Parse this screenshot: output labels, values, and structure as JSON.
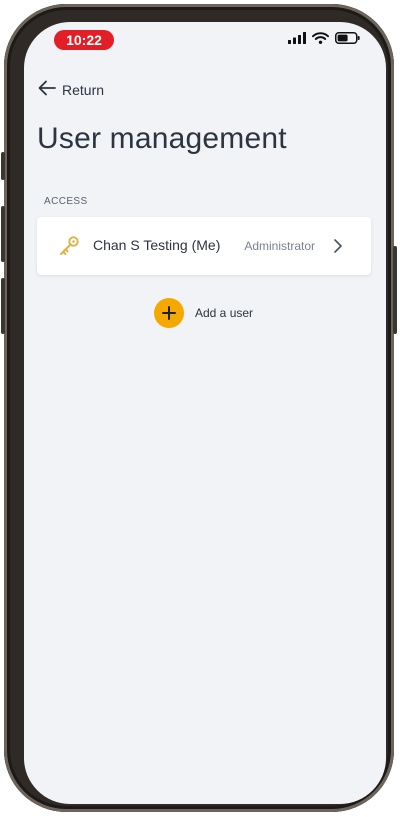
{
  "status_bar": {
    "time": "10:22",
    "time_pill_color": "#e21f26",
    "icons": [
      "signal-icon",
      "wifi-icon",
      "battery-icon"
    ]
  },
  "navigation": {
    "back_label": "Return",
    "back_icon": "arrow-left-icon"
  },
  "page": {
    "title": "User management"
  },
  "access_section": {
    "label": "ACCESS",
    "users": [
      {
        "name": "Chan S Testing (Me)",
        "role": "Administrator",
        "icon": "key-icon",
        "icon_color": "#d9b64a"
      }
    ]
  },
  "actions": {
    "add_user_label": "Add a user",
    "add_icon": "plus-icon",
    "accent_color": "#f5a800"
  }
}
